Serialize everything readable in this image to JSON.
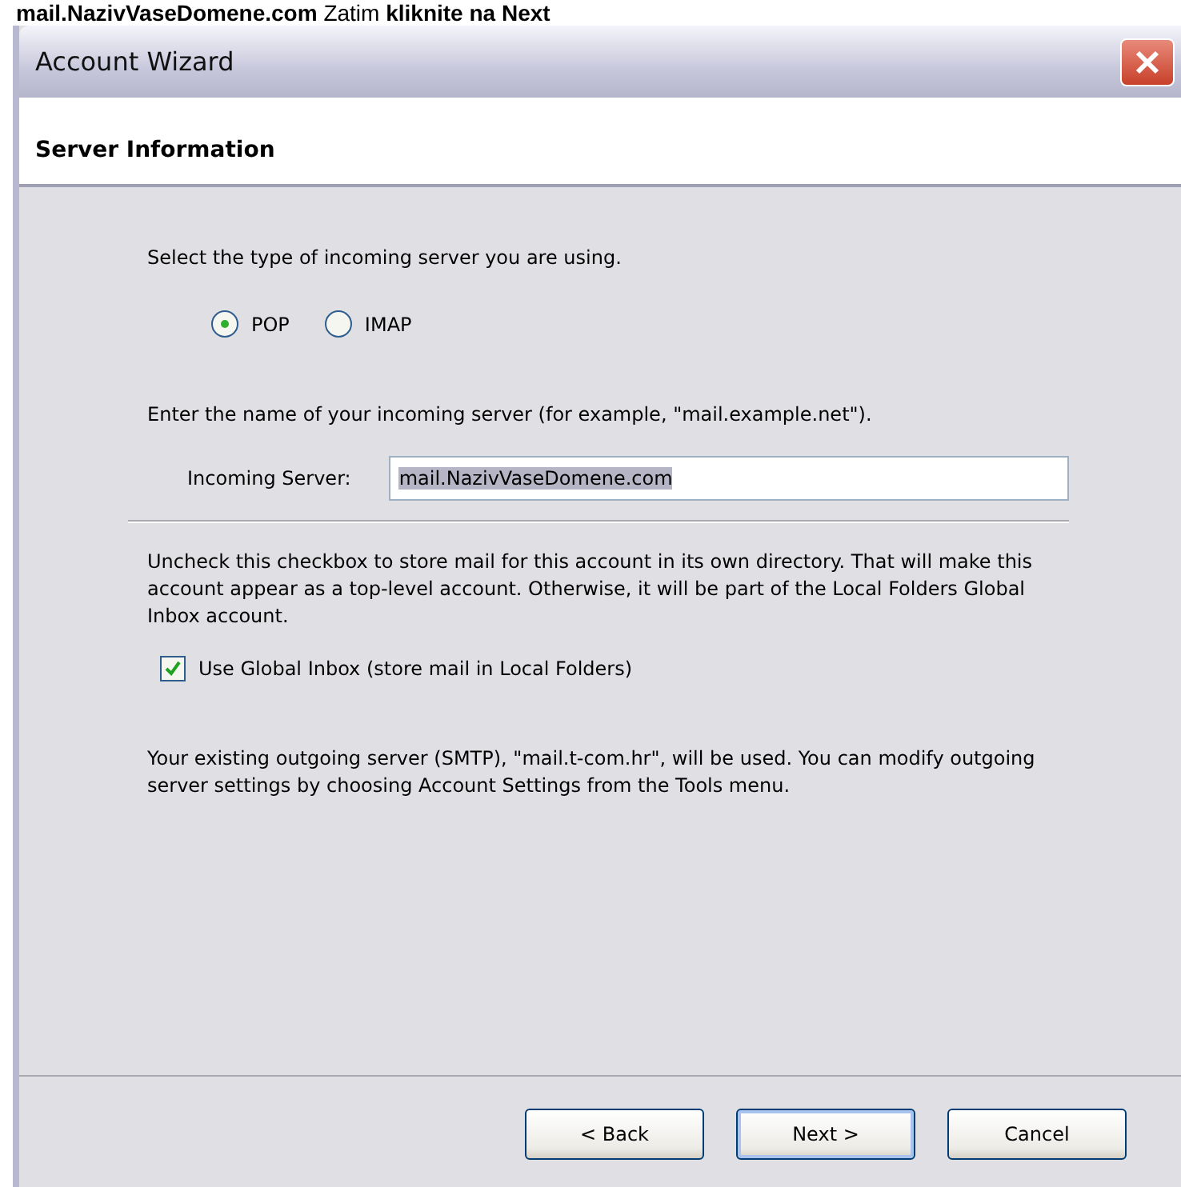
{
  "caption": "**mail.NazivVaseDomene.com** Zatim **kliknite na Next**",
  "window": {
    "title": "Account Wizard"
  },
  "header": {
    "title": "Server Information"
  },
  "server_type": {
    "prompt": "Select the type of incoming server you are using.",
    "options": [
      {
        "label": "POP",
        "selected": true
      },
      {
        "label": "IMAP",
        "selected": false
      }
    ]
  },
  "server_name": {
    "prompt": "Enter the name of your incoming server (for example, \"mail.example.net\").",
    "label": "Incoming Server:",
    "value": "mail.NazivVaseDomene.com"
  },
  "global_inbox": {
    "text": "Uncheck this checkbox to store mail for this account in its own directory. That will make this account appear as a top-level account. Otherwise, it will be part of the Local Folders Global Inbox account.",
    "label": "Use Global Inbox (store mail in Local Folders)",
    "checked": true
  },
  "outgoing_note": "Your existing outgoing server (SMTP), \"mail.t-com.hr\", will be used. You can modify outgoing server settings by choosing Account Settings from the Tools menu.",
  "buttons": [
    {
      "label": "< Back",
      "default": false
    },
    {
      "label": "Next >",
      "default": true
    },
    {
      "label": "Cancel",
      "default": false
    }
  ]
}
